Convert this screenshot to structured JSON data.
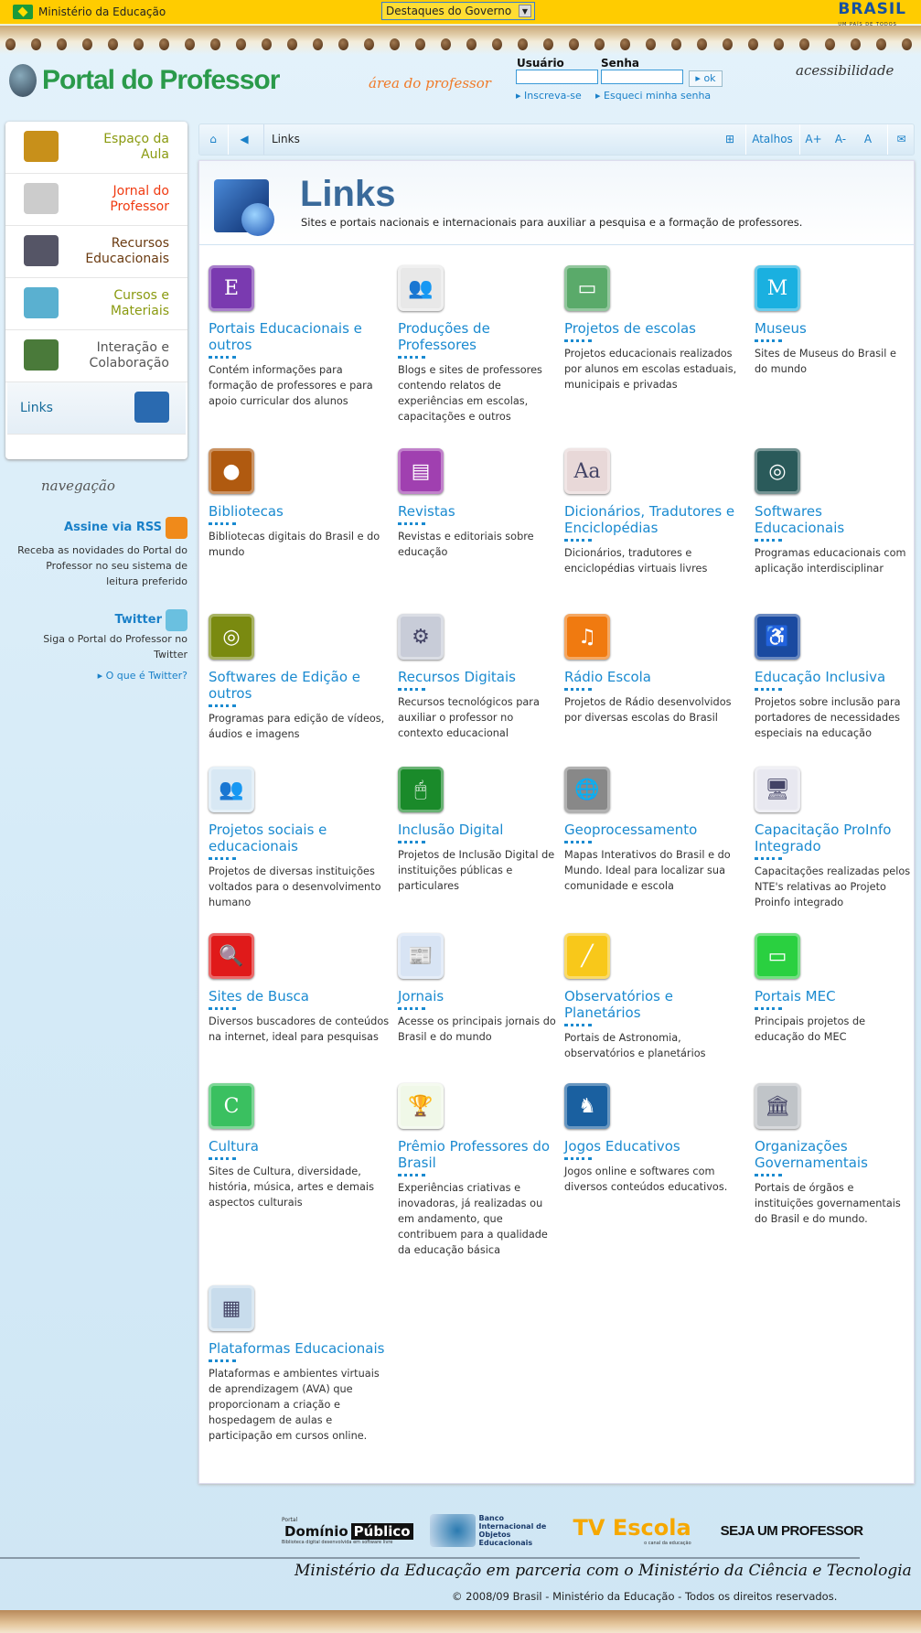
{
  "topbar": {
    "ministry": "Ministério da Educação",
    "select": "Destaques do Governo",
    "brand": "BRASIL",
    "brand_tagline": "UM PAÍS DE TODOS"
  },
  "header": {
    "logo": "Portal do Professor",
    "area": "área do professor",
    "user_label": "Usuário",
    "pass_label": "Senha",
    "ok": "ok",
    "signup": "Inscreva-se",
    "forgot": "Esqueci minha senha",
    "accessibility": "acessibilidade"
  },
  "sidebar": {
    "items": [
      {
        "label": "Espaço da Aula",
        "color": "#8a9a10"
      },
      {
        "label": "Jornal do Professor",
        "color": "#f03a10"
      },
      {
        "label": "Recursos Educacionais",
        "color": "#6a3a10"
      },
      {
        "label": "Cursos e Materiais",
        "color": "#8a9a10"
      },
      {
        "label": "Interação e Colaboração",
        "color": "#555555"
      },
      {
        "label": "Links",
        "color": "#136a9a"
      }
    ],
    "nav_caption": "navegação",
    "rss_title": "Assine via RSS",
    "rss_text": "Receba as novidades do Portal do Professor no seu sistema de leitura preferido",
    "twitter_title": "Twitter",
    "twitter_text": "Siga o Portal do Professor no Twitter",
    "twitter_link": "O que é Twitter?"
  },
  "toolbar": {
    "breadcrumb": "Links",
    "shortcuts": "Atalhos",
    "font_up": "A+",
    "font_down": "A-",
    "font_reset": "A"
  },
  "page": {
    "title": "Links",
    "subtitle": "Sites e portais nacionais e internacionais para auxiliar a pesquisa e a formação de professores."
  },
  "links": [
    {
      "title": "Portais Educacionais e outros",
      "desc": "Contém informações para formação de professores e para apoio curricular dos alunos",
      "color": "#7a3ab0",
      "glyph": "E"
    },
    {
      "title": "Produções de Professores",
      "desc": "Blogs e sites de professores contendo relatos de experiências em escolas, capacitações e outros",
      "color": "#e8e8e8",
      "glyph": "👥"
    },
    {
      "title": "Projetos de escolas",
      "desc": "Projetos educacionais realizados por alunos em escolas estaduais, municipais e privadas",
      "color": "#5aaa6a",
      "glyph": "▭"
    },
    {
      "title": "Museus",
      "desc": "Sites de Museus do Brasil e do mundo",
      "color": "#1ab0e0",
      "glyph": "M"
    },
    {
      "title": "Bibliotecas",
      "desc": "Bibliotecas digitais do Brasil e do mundo",
      "color": "#b05a10",
      "glyph": "●"
    },
    {
      "title": "Revistas",
      "desc": "Revistas e editoriais sobre educação",
      "color": "#a040b0",
      "glyph": "▤"
    },
    {
      "title": "Dicionários, Tradutores e Enciclopédias",
      "desc": "Dicionários, tradutores e enciclopédias virtuais livres",
      "color": "#e8d8d8",
      "glyph": "Aa"
    },
    {
      "title": "Softwares Educacionais",
      "desc": "Programas educacionais com aplicação interdisciplinar",
      "color": "#2a5a5a",
      "glyph": "◎"
    },
    {
      "title": "Softwares de Edição e outros",
      "desc": "Programas para edição de vídeos, áudios e imagens",
      "color": "#7a8a10",
      "glyph": "◎"
    },
    {
      "title": "Recursos Digitais",
      "desc": "Recursos tecnológicos para auxiliar o professor no contexto educacional",
      "color": "#c8ccd8",
      "glyph": "⚙"
    },
    {
      "title": "Rádio Escola",
      "desc": "Projetos de Rádio desenvolvidos por diversas escolas do Brasil",
      "color": "#f07a10",
      "glyph": "♫"
    },
    {
      "title": "Educação Inclusiva",
      "desc": "Projetos sobre inclusão para portadores de necessidades especiais na educação",
      "color": "#1a4aa0",
      "glyph": "♿"
    },
    {
      "title": "Projetos sociais e educacionais",
      "desc": "Projetos de diversas instituições voltados para o desenvolvimento humano",
      "color": "#d8e8f4",
      "glyph": "👥"
    },
    {
      "title": "Inclusão Digital",
      "desc": "Projetos de Inclusão Digital de instituições públicas e particulares",
      "color": "#1a8a2a",
      "glyph": "🖱"
    },
    {
      "title": "Geoprocessamento",
      "desc": "Mapas Interativos do Brasil e do Mundo. Ideal para localizar sua comunidade e escola",
      "color": "#888888",
      "glyph": "🌐"
    },
    {
      "title": "Capacitação ProInfo Integrado",
      "desc": "Capacitações realizadas pelos NTE's relativas ao Projeto Proinfo integrado",
      "color": "#e8e8f0",
      "glyph": "🖥"
    },
    {
      "title": "Sites de Busca",
      "desc": "Diversos buscadores de conteúdos na internet, ideal para pesquisas",
      "color": "#e01a1a",
      "glyph": "🔍"
    },
    {
      "title": "Jornais",
      "desc": "Acesse os principais jornais do Brasil e do mundo",
      "color": "#d8e4f4",
      "glyph": "📰"
    },
    {
      "title": "Observatórios e Planetários",
      "desc": "Portais de Astronomia, observatórios e planetários",
      "color": "#f8c81a",
      "glyph": "╱"
    },
    {
      "title": "Portais MEC",
      "desc": "Principais projetos de educação do MEC",
      "color": "#2ad040",
      "glyph": "▭"
    },
    {
      "title": "Cultura",
      "desc": "Sites de Cultura, diversidade, história, música, artes e demais aspectos culturais",
      "color": "#3ac060",
      "glyph": "C"
    },
    {
      "title": "Prêmio Professores do Brasil",
      "desc": "Experiências criativas e inovadoras, já realizadas ou em andamento, que contribuem para a qualidade da educação básica",
      "color": "#f0f8e8",
      "glyph": "🏆"
    },
    {
      "title": "Jogos Educativos",
      "desc": "Jogos online e softwares com diversos conteúdos educativos.",
      "color": "#1a60a0",
      "glyph": "♞"
    },
    {
      "title": "Organizações Governamentais",
      "desc": "Portais de órgãos e instituições governamentais do Brasil e do mundo.",
      "color": "#c0c4c8",
      "glyph": "🏛"
    },
    {
      "title": "Plataformas Educacionais",
      "desc": "Plataformas e ambientes virtuais de aprendizagem (AVA) que proporcionam a criação e hospedagem de aulas e participação em cursos online.",
      "color": "#c8dcec",
      "glyph": "▦"
    }
  ],
  "footer": {
    "dominio_small": "Portal",
    "dominio_a": "Domínio",
    "dominio_b": "Público",
    "dominio_tag": "Biblioteca digital desenvolvida em software livre",
    "bioe": "Banco Internacional de Objetos Educacionais",
    "tv": "TV Escola",
    "tv_tag": "o canal da educação",
    "seja": "SEJA UM PROFESSOR",
    "partnership": "Ministério da Educação em parceria com o Ministério da Ciência e Tecnologia",
    "copyright": "© 2008/09 Brasil - Ministério da Educação - Todos os direitos reservados."
  }
}
